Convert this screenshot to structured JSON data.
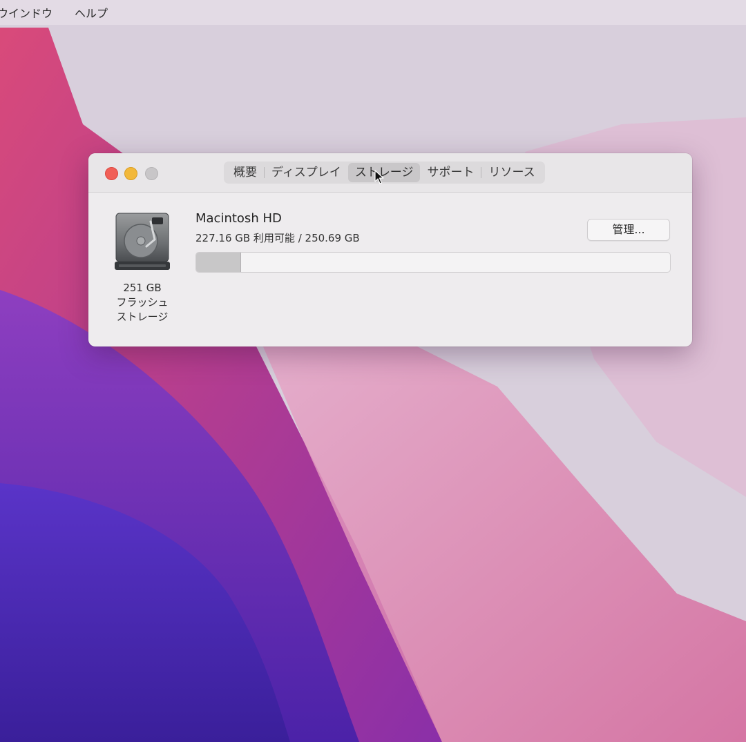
{
  "menubar": {
    "items": [
      "ウインドウ",
      "ヘルプ"
    ]
  },
  "window": {
    "tabs": [
      {
        "label": "概要",
        "active": false
      },
      {
        "label": "ディスプレイ",
        "active": false
      },
      {
        "label": "ストレージ",
        "active": true
      },
      {
        "label": "サポート",
        "active": false
      },
      {
        "label": "リソース",
        "active": false
      }
    ],
    "disk": {
      "icon": "hard-drive-icon",
      "caption_line1": "251 GB",
      "caption_line2": "フラッシュ",
      "caption_line3": "ストレージ"
    },
    "volume": {
      "name": "Macintosh HD",
      "usage_text": "227.16 GB 利用可能 / 250.69 GB",
      "used_fraction": 0.094
    },
    "manage_label": "管理..."
  },
  "colors": {
    "close": "#f15f57",
    "minimize": "#f2b83a",
    "zoom": "#c8c6c8"
  }
}
